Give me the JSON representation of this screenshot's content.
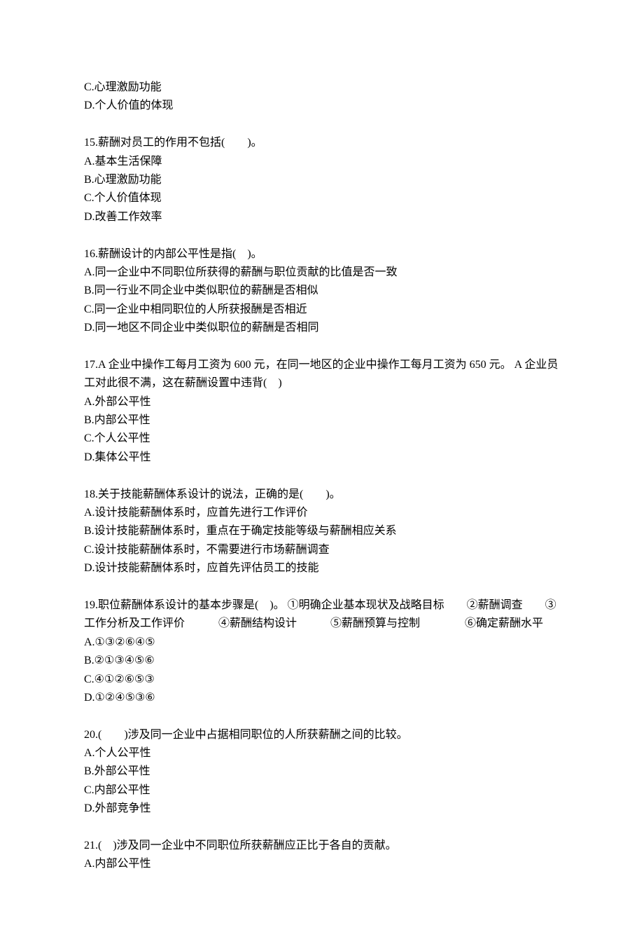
{
  "orphan": {
    "c": "C.心理激励功能",
    "d": "D.个人价值的体现"
  },
  "q15": {
    "stem": "15.薪酬对员工的作用不包括(　　)。",
    "a": "A.基本生活保障",
    "b": "B.心理激励功能",
    "c": "C.个人价值体现",
    "d": "D.改善工作效率"
  },
  "q16": {
    "stem": "16.薪酬设计的内部公平性是指(　)。",
    "a": "A.同一企业中不同职位所获得的薪酬与职位贡献的比值是否一致",
    "b": "B.同一行业不同企业中类似职位的薪酬是否相似",
    "c": "C.同一企业中相同职位的人所获报酬是否相近",
    "d": "D.同一地区不同企业中类似职位的薪酬是否相同"
  },
  "q17": {
    "stem": "17.A 企业中操作工每月工资为 600 元，在同一地区的企业中操作工每月工资为 650 元。 A 企业员工对此很不满，这在薪酬设置中违背(　)",
    "a": "A.外部公平性",
    "b": "B.内部公平性",
    "c": "C.个人公平性",
    "d": "D.集体公平性"
  },
  "q18": {
    "stem": "18.关于技能薪酬体系设计的说法，正确的是(　　)。",
    "a": "A.设计技能薪酬体系时，应首先进行工作评价",
    "b": "B.设计技能薪酬体系时，重点在于确定技能等级与薪酬相应关系",
    "c": "C.设计技能薪酬体系时，不需要进行市场薪酬调查",
    "d": "D.设计技能薪酬体系时，应首先评估员工的技能"
  },
  "q19": {
    "stem": "19.职位薪酬体系设计的基本步骤是(　)。 ①明确企业基本现状及战略目标　　②薪酬调查　　③工作分析及工作评价　　　④薪酬结构设计　　　⑤薪酬预算与控制　　　　⑥确定薪酬水平",
    "a": "A.①③②⑥④⑤",
    "b": "B.②①③④⑤⑥",
    "c": "C.④①②⑥⑤③",
    "d": "D.①②④⑤③⑥"
  },
  "q20": {
    "stem": "20.(　　)涉及同一企业中占据相同职位的人所获薪酬之间的比较。",
    "a": "A.个人公平性",
    "b": "B.外部公平性",
    "c": "C.内部公平性",
    "d": "D.外部竞争性"
  },
  "q21": {
    "stem": "21.(　)涉及同一企业中不同职位所获薪酬应正比于各自的贡献。",
    "a": "A.内部公平性"
  }
}
